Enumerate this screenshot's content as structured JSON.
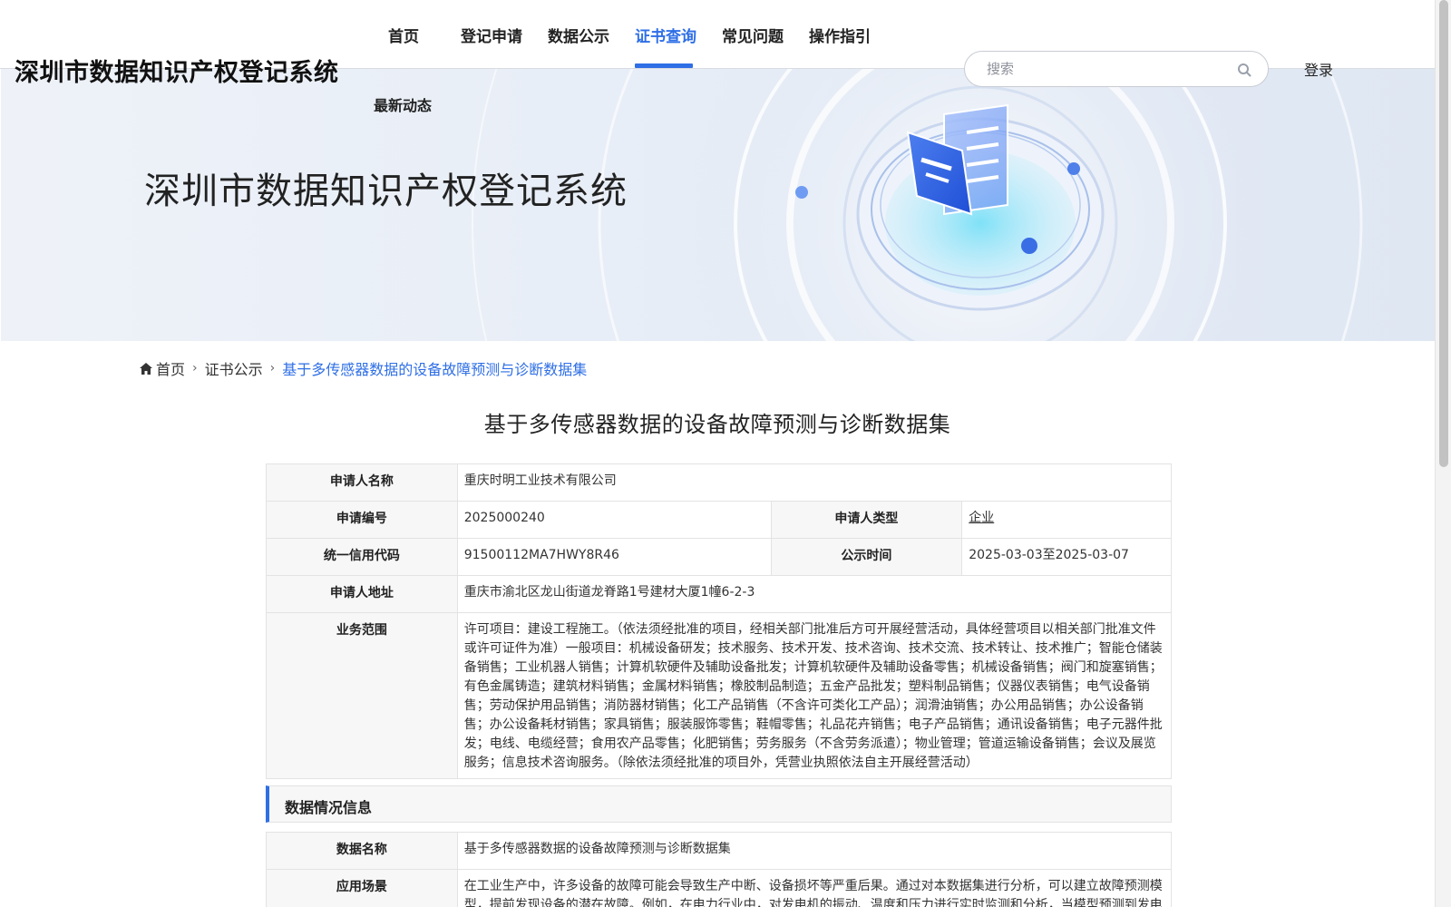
{
  "header": {
    "site_title": "深圳市数据知识产权登记系统",
    "nav": [
      {
        "label": "首页",
        "active": false
      },
      {
        "label": "登记申请",
        "active": false
      },
      {
        "label": "数据公示",
        "active": false
      },
      {
        "label": "证书查询",
        "active": true
      },
      {
        "label": "常见问题",
        "active": false
      },
      {
        "label": "操作指引",
        "active": false
      },
      {
        "label": "最新动态",
        "active": false
      }
    ],
    "search_placeholder": "搜索",
    "login_label": "登录",
    "accent_color": "#2f6fe6"
  },
  "banner": {
    "title": "深圳市数据知识产权登记系统"
  },
  "breadcrumb": [
    {
      "label": "首页",
      "icon": "home-icon"
    },
    {
      "label": "证书公示"
    },
    {
      "label": "基于多传感器数据的设备故障预测与诊断数据集",
      "current": true
    }
  ],
  "page_title": "基于多传感器数据的设备故障预测与诊断数据集",
  "applicant": {
    "name_label": "申请人名称",
    "name": "重庆时明工业技术有限公司",
    "number_label": "申请编号",
    "number": "2025000240",
    "type_label": "申请人类型",
    "type": "企业",
    "credit_code_label": "统一信用代码",
    "credit_code": "91500112MA7HWY8R46",
    "publicity_label": "公示时间",
    "publicity": "2025-03-03至2025-03-07",
    "address_label": "申请人地址",
    "address": "重庆市渝北区龙山街道龙脊路1号建材大厦1幢6-2-3",
    "scope_label": "业务范围",
    "scope": "许可项目：建设工程施工。（依法须经批准的项目，经相关部门批准后方可开展经营活动，具体经营项目以相关部门批准文件或许可证件为准）一般项目：机械设备研发；技术服务、技术开发、技术咨询、技术交流、技术转让、技术推广；智能仓储装备销售；工业机器人销售；计算机软硬件及辅助设备批发；计算机软硬件及辅助设备零售；机械设备销售；阀门和旋塞销售；有色金属铸造；建筑材料销售；金属材料销售；橡胶制品制造；五金产品批发；塑料制品销售；仪器仪表销售；电气设备销售；劳动保护用品销售；消防器材销售；化工产品销售（不含许可类化工产品）；润滑油销售；办公用品销售；办公设备销售；办公设备耗材销售；家具销售；服装服饰零售；鞋帽零售；礼品花卉销售；电子产品销售；通讯设备销售；电子元器件批发；电线、电缆经营；食用农产品零售；化肥销售；劳务服务（不含劳务派遣）；物业管理；管道运输设备销售；会议及展览服务；信息技术咨询服务。（除依法须经批准的项目外，凭营业执照依法自主开展经营活动）"
  },
  "data_section": {
    "title": "数据情况信息",
    "data_name_label": "数据名称",
    "data_name": "基于多传感器数据的设备故障预测与诊断数据集",
    "scenario_label": "应用场景",
    "scenario": "在工业生产中，许多设备的故障可能会导致生产中断、设备损坏等严重后果。通过对本数据集进行分析，可以建立故障预测模型，提前发现设备的潜在故障。例如，在电力行业中，对发电机的振动、温度和压力进行实时监测和分析，当模型预测到发电"
  }
}
